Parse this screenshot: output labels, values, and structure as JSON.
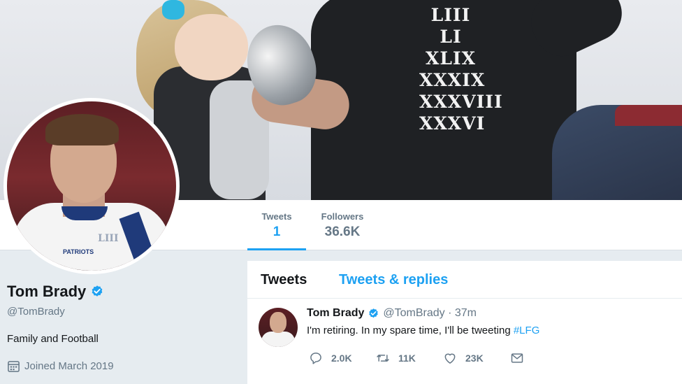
{
  "profile": {
    "name": "Tom Brady",
    "handle": "@TomBrady",
    "bio": "Family and Football",
    "joined": "Joined March 2019"
  },
  "stats": [
    {
      "label": "Tweets",
      "value": "1"
    },
    {
      "label": "Followers",
      "value": "36.6K"
    }
  ],
  "banner": {
    "shirt_numerals": [
      "LIII",
      "LI",
      "XLIX",
      "XXXIX",
      "XXXVIII",
      "XXXVI"
    ],
    "avatar_jersey_text": "PATRIOTS",
    "avatar_patch_text": "LIII"
  },
  "timeline": {
    "tabs": [
      "Tweets",
      "Tweets & replies"
    ],
    "tweet": {
      "name": "Tom Brady",
      "handle_time": "@TomBrady · 37m",
      "text": "I'm retiring. In my spare time, I'll be tweeting ",
      "hashtag": "#LFG",
      "replies": "2.0K",
      "retweets": "11K",
      "likes": "23K"
    }
  },
  "colors": {
    "accent": "#1da1f2",
    "muted": "#657786",
    "background": "#e6ecf0"
  },
  "icons": [
    "verified-badge-icon",
    "calendar-icon",
    "reply-icon",
    "retweet-icon",
    "like-icon",
    "direct-message-icon"
  ]
}
